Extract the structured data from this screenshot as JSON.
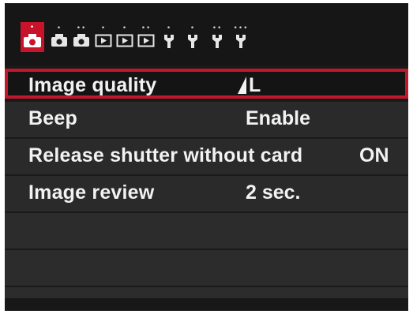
{
  "tabs": [
    {
      "icon": "camera-icon",
      "dots": "•",
      "active": true
    },
    {
      "icon": "camera-icon",
      "dots": "•"
    },
    {
      "icon": "camera-icon",
      "dots": "••"
    },
    {
      "icon": "playback-icon",
      "dots": "•"
    },
    {
      "icon": "playback-icon",
      "dots": "•"
    },
    {
      "icon": "playback-icon",
      "dots": "••"
    },
    {
      "icon": "wrench-icon",
      "dots": "•"
    },
    {
      "icon": "wrench-icon",
      "dots": "•"
    },
    {
      "icon": "wrench-icon",
      "dots": "••"
    },
    {
      "icon": "wrench-icon",
      "dots": "•••"
    }
  ],
  "menu": {
    "items": [
      {
        "label": "Image quality",
        "value": "L",
        "value_icon": "quality-fine-icon",
        "selected": true
      },
      {
        "label": "Beep",
        "value": "Enable"
      },
      {
        "label": "Release shutter without card",
        "value": "ON"
      },
      {
        "label": "Image review",
        "value": "2 sec."
      }
    ]
  },
  "colors": {
    "accent": "#c3162b",
    "background": "#1a1a1a",
    "row": "#2a2a2a",
    "text": "#f2f2f2"
  }
}
